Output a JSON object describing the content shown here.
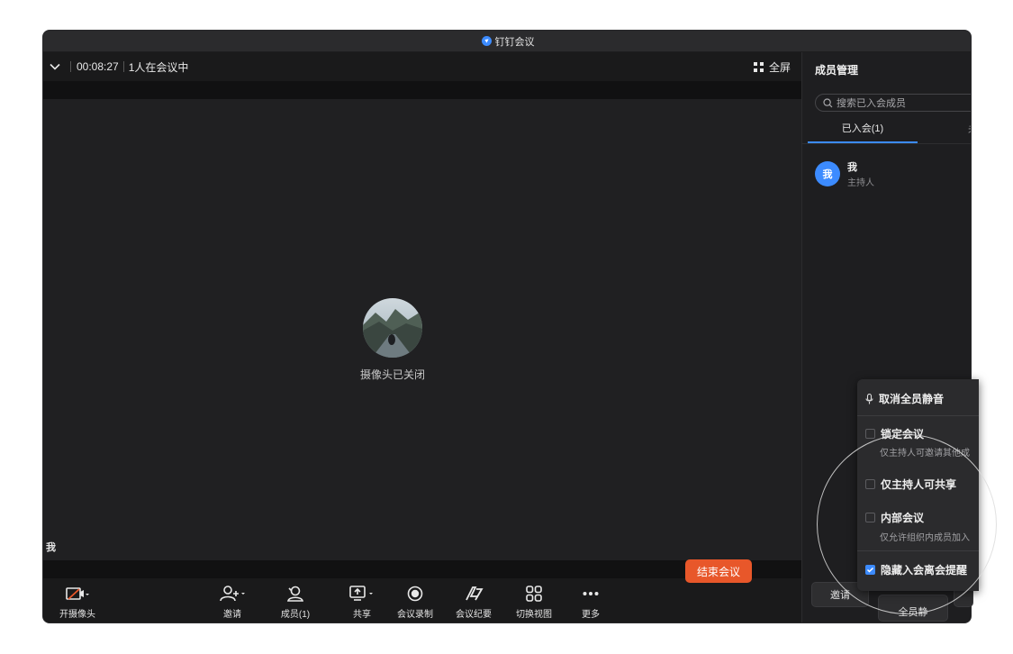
{
  "window": {
    "title": "钉钉会议"
  },
  "topbar": {
    "timer": "00:08:27",
    "participants_text": "1人在会议中",
    "fullscreen_label": "全屏"
  },
  "stage": {
    "camera_off_text": "摄像头已关闭",
    "speaker_label": "我"
  },
  "toolbar": {
    "camera": "开摄像头",
    "invite": "邀请",
    "members": "成员(1)",
    "share": "共享",
    "record": "会议录制",
    "minutes": "会议纪要",
    "switch_view": "切换视图",
    "more": "更多",
    "end_meeting": "结束会议"
  },
  "panel": {
    "title": "成员管理",
    "search_placeholder": "搜索已入会成员",
    "tabs": {
      "joined": "已入会(1)",
      "not_joined": "未入"
    },
    "members": [
      {
        "avatar_text": "我",
        "name": "我",
        "role": "主持人"
      }
    ],
    "bottom_buttons": {
      "invite": "邀请",
      "mute_all": "全员静"
    }
  },
  "popup": {
    "unmute_all": "取消全员静音",
    "lock_meeting": "锁定会议",
    "lock_meeting_desc": "仅主持人可邀请其他成",
    "host_only_share": "仅主持人可共享",
    "internal_meeting": "内部会议",
    "internal_meeting_desc": "仅允许组织内成员加入",
    "hide_join_leave": "隐藏入会离会提醒",
    "hide_join_leave_checked": true
  },
  "colors": {
    "accent": "#3c8bff",
    "danger": "#e8572a",
    "background": "#111112"
  }
}
